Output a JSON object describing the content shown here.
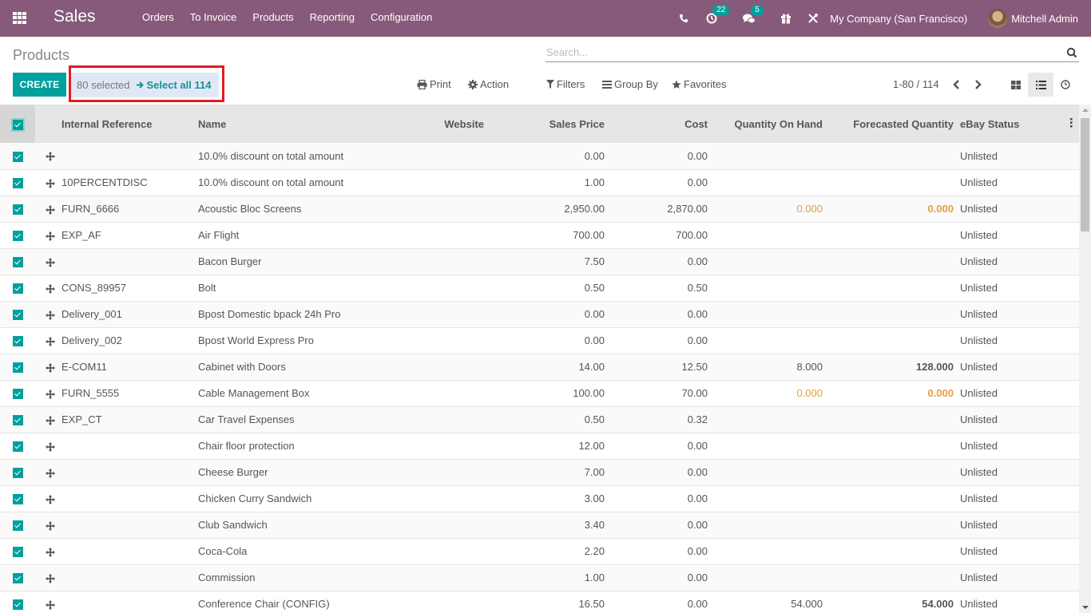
{
  "navbar": {
    "app_name": "Sales",
    "menu": [
      "Orders",
      "To Invoice",
      "Products",
      "Reporting",
      "Configuration"
    ],
    "activity_badge": "22",
    "messages_badge": "5",
    "company": "My Company (San Francisco)",
    "user": "Mitchell Admin",
    "icons": [
      "apps-icon",
      "phone-icon",
      "clock-icon",
      "chat-icon",
      "gift-icon",
      "tools-icon"
    ]
  },
  "control_panel": {
    "title": "Products",
    "search_placeholder": "Search...",
    "create_label": "CREATE",
    "selected_text": "80 selected",
    "select_all_label": "Select all 114",
    "print_label": "Print",
    "action_label": "Action",
    "filters_label": "Filters",
    "group_by_label": "Group By",
    "favorites_label": "Favorites",
    "pager": "1-80 / 114",
    "active_view": "list"
  },
  "colors": {
    "brand": "#875a7b",
    "primary": "#00a09d",
    "selection_highlight": "#e31b23",
    "warning": "#e0a040"
  },
  "table": {
    "columns": [
      "Internal Reference",
      "Name",
      "Website",
      "Sales Price",
      "Cost",
      "Quantity On Hand",
      "Forecasted Quantity",
      "eBay Status"
    ],
    "rows": [
      {
        "ref": "",
        "name": "10.0% discount on total amount",
        "website": "",
        "price": "0.00",
        "cost": "0.00",
        "qoh": "",
        "forecast": "",
        "ebay": "Unlisted",
        "warn": false
      },
      {
        "ref": "10PERCENTDISC",
        "name": "10.0% discount on total amount",
        "website": "",
        "price": "1.00",
        "cost": "0.00",
        "qoh": "",
        "forecast": "",
        "ebay": "Unlisted",
        "warn": false
      },
      {
        "ref": "FURN_6666",
        "name": "Acoustic Bloc Screens",
        "website": "",
        "price": "2,950.00",
        "cost": "2,870.00",
        "qoh": "0.000",
        "forecast": "0.000",
        "ebay": "Unlisted",
        "warn": true
      },
      {
        "ref": "EXP_AF",
        "name": "Air Flight",
        "website": "",
        "price": "700.00",
        "cost": "700.00",
        "qoh": "",
        "forecast": "",
        "ebay": "Unlisted",
        "warn": false
      },
      {
        "ref": "",
        "name": "Bacon Burger",
        "website": "",
        "price": "7.50",
        "cost": "0.00",
        "qoh": "",
        "forecast": "",
        "ebay": "Unlisted",
        "warn": false
      },
      {
        "ref": "CONS_89957",
        "name": "Bolt",
        "website": "",
        "price": "0.50",
        "cost": "0.50",
        "qoh": "",
        "forecast": "",
        "ebay": "Unlisted",
        "warn": false
      },
      {
        "ref": "Delivery_001",
        "name": "Bpost Domestic bpack 24h Pro",
        "website": "",
        "price": "0.00",
        "cost": "0.00",
        "qoh": "",
        "forecast": "",
        "ebay": "Unlisted",
        "warn": false
      },
      {
        "ref": "Delivery_002",
        "name": "Bpost World Express Pro",
        "website": "",
        "price": "0.00",
        "cost": "0.00",
        "qoh": "",
        "forecast": "",
        "ebay": "Unlisted",
        "warn": false
      },
      {
        "ref": "E-COM11",
        "name": "Cabinet with Doors",
        "website": "",
        "price": "14.00",
        "cost": "12.50",
        "qoh": "8.000",
        "forecast": "128.000",
        "ebay": "Unlisted",
        "warn": false
      },
      {
        "ref": "FURN_5555",
        "name": "Cable Management Box",
        "website": "",
        "price": "100.00",
        "cost": "70.00",
        "qoh": "0.000",
        "forecast": "0.000",
        "ebay": "Unlisted",
        "warn": true
      },
      {
        "ref": "EXP_CT",
        "name": "Car Travel Expenses",
        "website": "",
        "price": "0.50",
        "cost": "0.32",
        "qoh": "",
        "forecast": "",
        "ebay": "Unlisted",
        "warn": false
      },
      {
        "ref": "",
        "name": "Chair floor protection",
        "website": "",
        "price": "12.00",
        "cost": "0.00",
        "qoh": "",
        "forecast": "",
        "ebay": "Unlisted",
        "warn": false
      },
      {
        "ref": "",
        "name": "Cheese Burger",
        "website": "",
        "price": "7.00",
        "cost": "0.00",
        "qoh": "",
        "forecast": "",
        "ebay": "Unlisted",
        "warn": false
      },
      {
        "ref": "",
        "name": "Chicken Curry Sandwich",
        "website": "",
        "price": "3.00",
        "cost": "0.00",
        "qoh": "",
        "forecast": "",
        "ebay": "Unlisted",
        "warn": false
      },
      {
        "ref": "",
        "name": "Club Sandwich",
        "website": "",
        "price": "3.40",
        "cost": "0.00",
        "qoh": "",
        "forecast": "",
        "ebay": "Unlisted",
        "warn": false
      },
      {
        "ref": "",
        "name": "Coca-Cola",
        "website": "",
        "price": "2.20",
        "cost": "0.00",
        "qoh": "",
        "forecast": "",
        "ebay": "Unlisted",
        "warn": false
      },
      {
        "ref": "",
        "name": "Commission",
        "website": "",
        "price": "1.00",
        "cost": "0.00",
        "qoh": "",
        "forecast": "",
        "ebay": "Unlisted",
        "warn": false
      },
      {
        "ref": "",
        "name": "Conference Chair (CONFIG)",
        "website": "",
        "price": "16.50",
        "cost": "0.00",
        "qoh": "54.000",
        "forecast": "54.000",
        "ebay": "Unlisted",
        "warn": false
      }
    ]
  }
}
